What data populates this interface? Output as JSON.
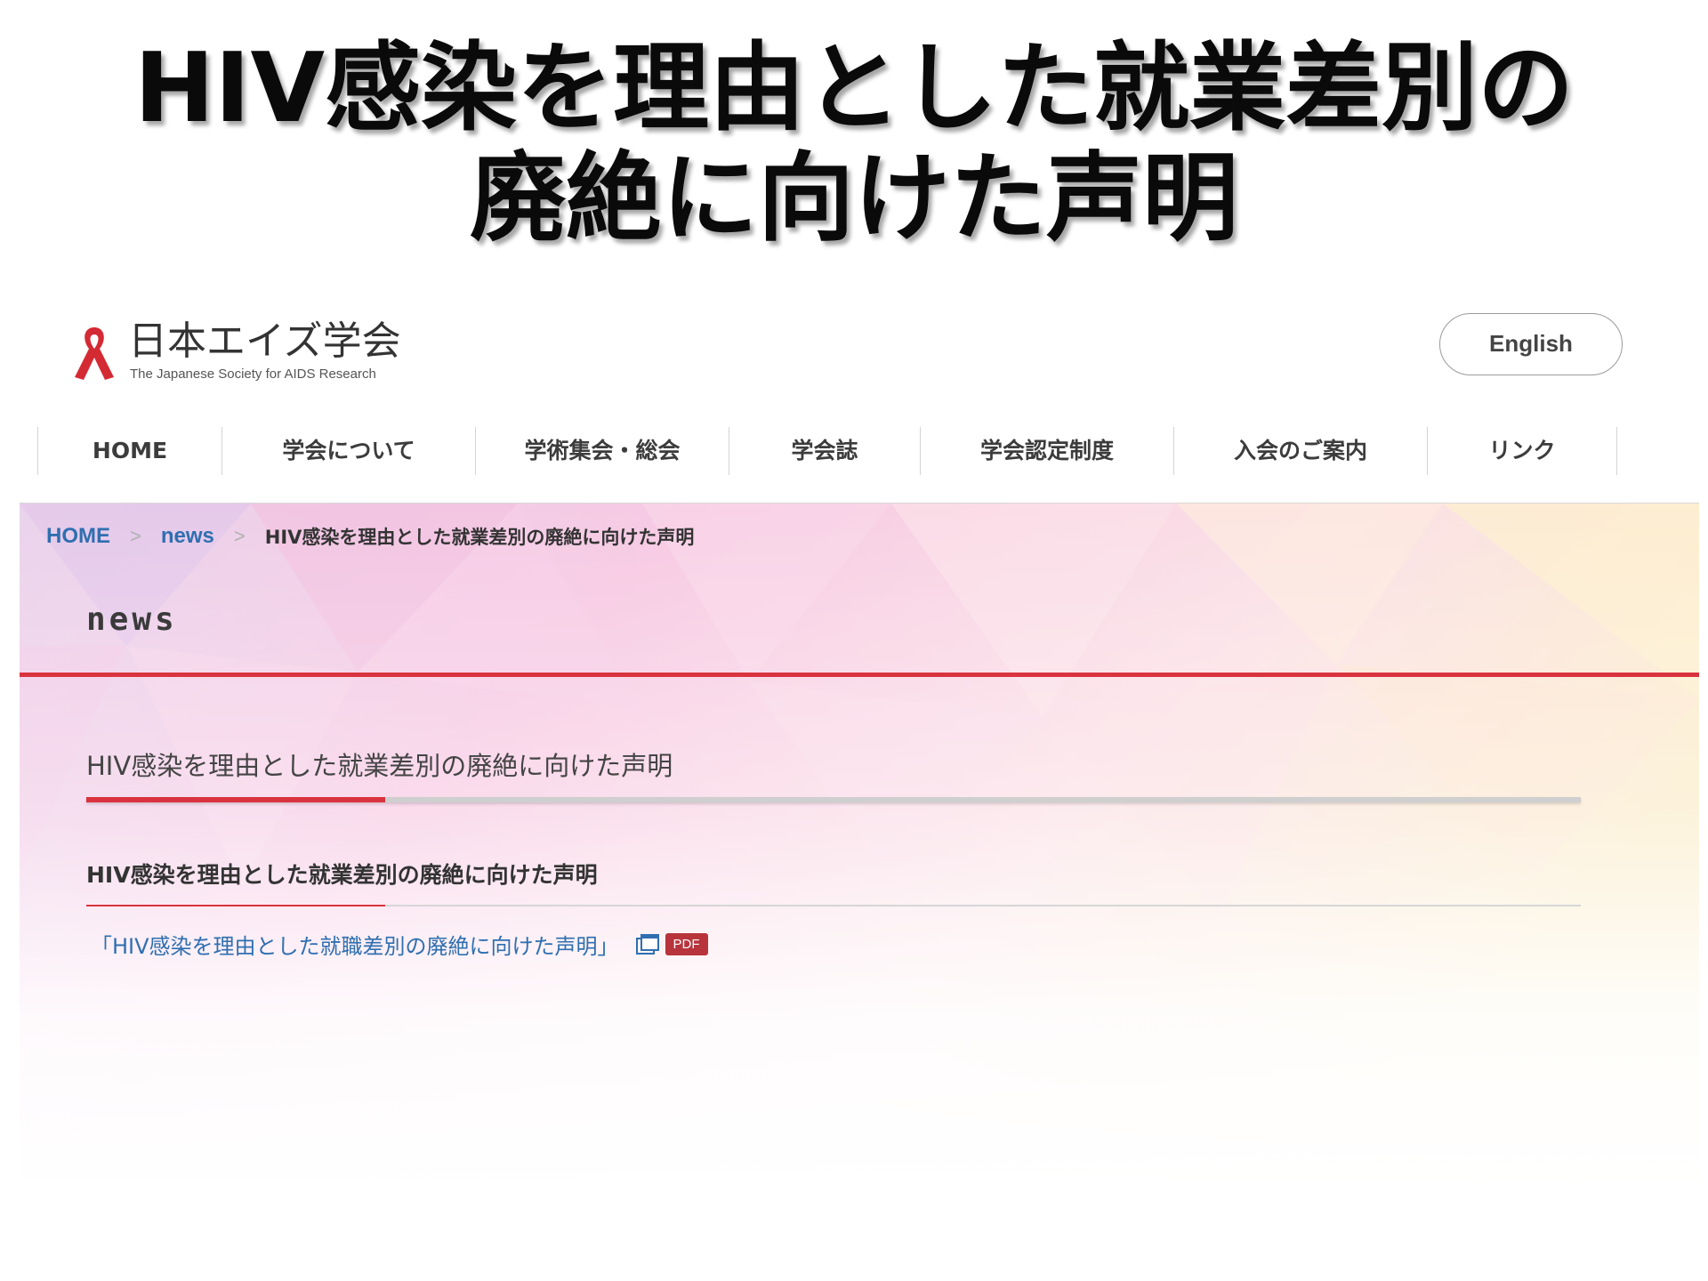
{
  "slide": {
    "title_line1": "HIV感染を理由とした就業差別の",
    "title_line2": "廃絶に向けた声明"
  },
  "header": {
    "logo_name": "日本エイズ学会",
    "logo_subtitle": "The Japanese Society for AIDS Research",
    "language_button": "English"
  },
  "nav": {
    "items": [
      {
        "label": "HOME"
      },
      {
        "label": "学会について"
      },
      {
        "label": "学術集会・総会"
      },
      {
        "label": "学会誌"
      },
      {
        "label": "学会認定制度"
      },
      {
        "label": "入会のご案内"
      },
      {
        "label": "リンク"
      }
    ]
  },
  "breadcrumb": {
    "home": "HOME",
    "separator": ">",
    "section": "news",
    "current": "HIV感染を理由とした就業差別の廃絶に向けた声明"
  },
  "page": {
    "section_label": "news",
    "article_title": "HIV感染を理由とした就業差別の廃絶に向けた声明",
    "sub_heading": "HIV感染を理由とした就業差別の廃絶に向けた声明",
    "document_link": "「HIV感染を理由とした就職差別の廃絶に向けた声明」",
    "document_link_icon": "new-window-icon",
    "pdf_badge": "PDF"
  },
  "colors": {
    "accent_red": "#d9333f",
    "link_blue": "#2f6fb0",
    "ribbon_red": "#d42a34",
    "pdf_badge": "#b8343c"
  }
}
